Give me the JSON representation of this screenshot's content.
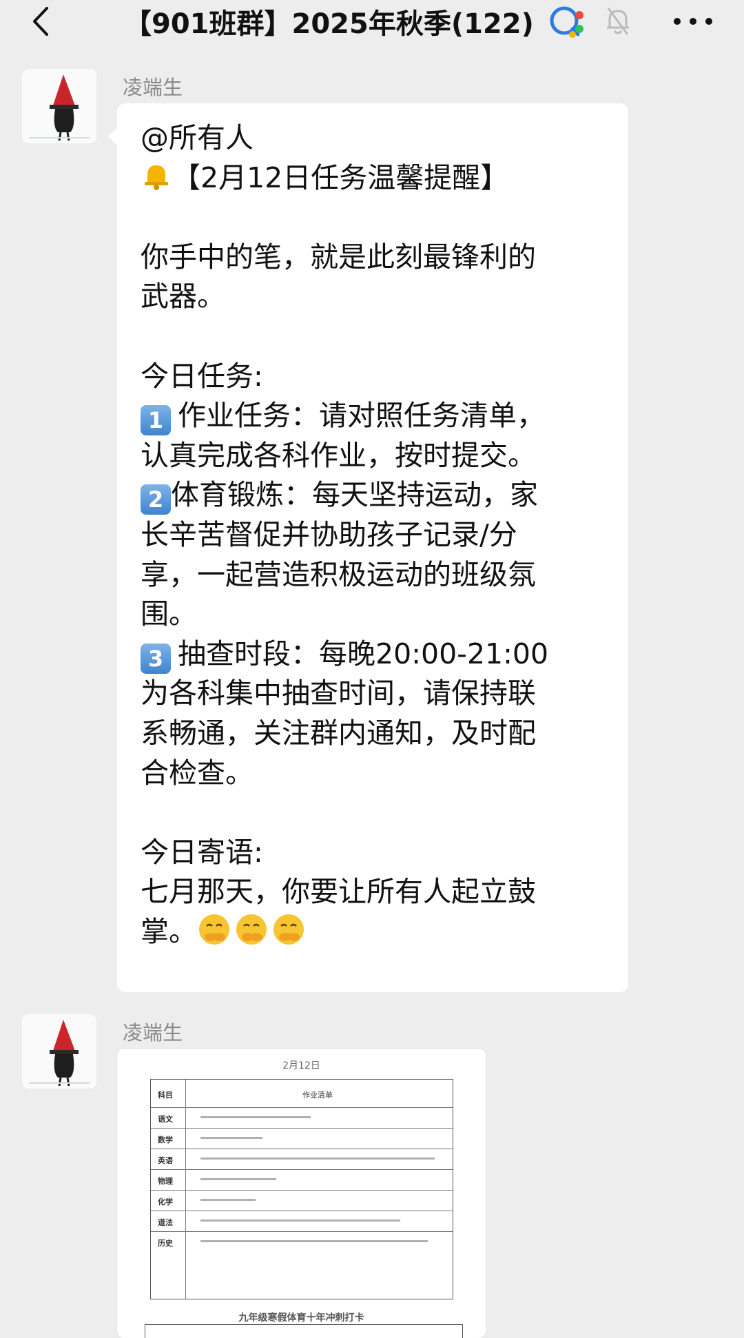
{
  "header": {
    "title": "【901班群】2025年秋季(122)",
    "icons": [
      "back-chevron-icon",
      "group-badge-icon",
      "mute-bell-icon",
      "more-dots-icon"
    ]
  },
  "messages": [
    {
      "sender": "凌端生",
      "lines": [
        "@所有人",
        "【2月12日任务温馨提醒】",
        "",
        "你手中的笔，就是此刻最锋利的",
        "武器。",
        "",
        "今日任务:",
        "作业任务：请对照任务清单，",
        "认真完成各科作业，按时提交。",
        "体育锻炼：每天坚持运动，家",
        "长辛苦督促并协助孩子记录/分",
        "享，一起营造积极运动的班级氛",
        "围。",
        "抽查时段：每晚20:00-21:00",
        "为各科集中抽查时间，请保持联",
        "系畅通，关注群内通知，及时配",
        "合检查。",
        "",
        "今日寄语:",
        "七月那天，你要让所有人起立鼓",
        "掌。"
      ],
      "keycaps": [
        "1",
        "2",
        "3"
      ]
    },
    {
      "sender": "凌端生",
      "image": {
        "doc_title": "2月12日",
        "header_col": "科目",
        "header_col2": "作业清单",
        "subjects": [
          "语文",
          "数学",
          "英语",
          "物理",
          "化学",
          "道法",
          "历史"
        ],
        "second_title": "九年级寒假体育十年冲刺打卡"
      }
    }
  ],
  "colors": {
    "background": "#ededed",
    "bubble": "#ffffff",
    "sender_name": "#8a8a8a",
    "keycap": "#4a8fd6"
  }
}
